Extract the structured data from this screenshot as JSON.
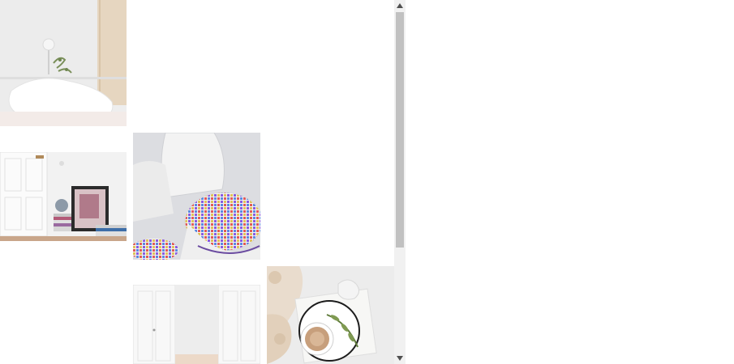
{
  "gallery": {
    "images": [
      {
        "subject": "bedroom-lamp-pillow"
      },
      {
        "subject": "white-door-with-framed-poster-and-books"
      },
      {
        "subject": "white-tulip-chair-with-checkered-cushion"
      },
      {
        "subject": "white-double-doors-hallway"
      },
      {
        "subject": "coffee-cup-on-marble-tray-with-knit"
      }
    ]
  },
  "scrollbar": {
    "up_icon": "triangle-up",
    "down_icon": "triangle-down",
    "position": 0.0
  }
}
